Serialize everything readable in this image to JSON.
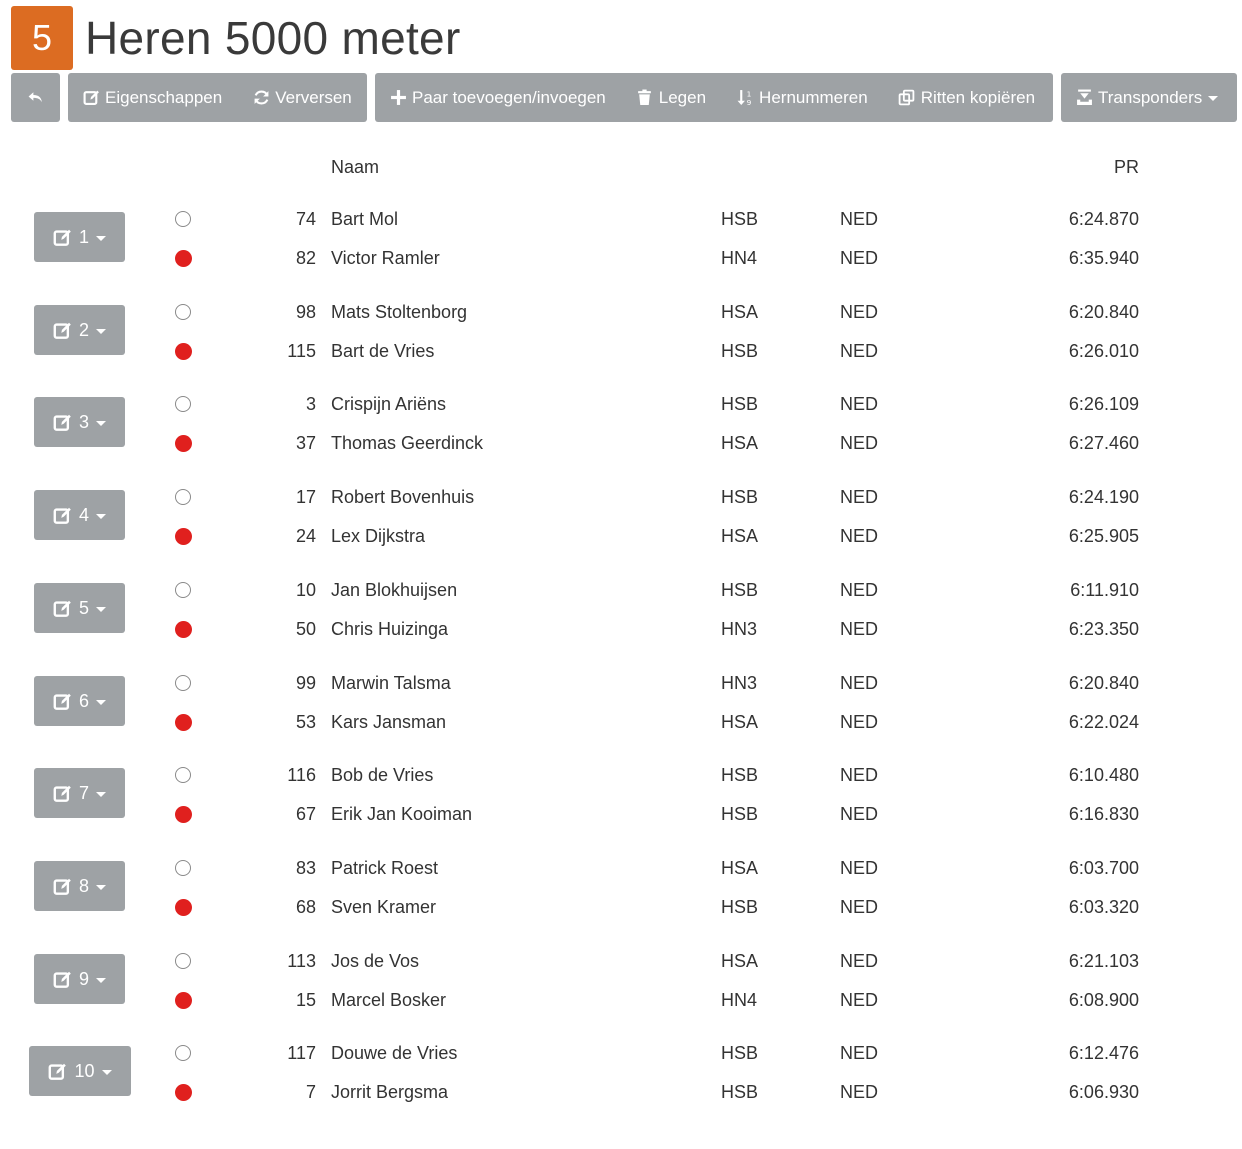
{
  "header": {
    "badge": "5",
    "title": "Heren 5000 meter"
  },
  "toolbar": {
    "back_icon": "back-arrow-icon",
    "properties": "Eigenschappen",
    "refresh": "Verversen",
    "add_pair": "Paar toevoegen/invoegen",
    "clear": "Legen",
    "renumber": "Hernummeren",
    "copy_heats": "Ritten kopiëren",
    "transponders": "Transponders"
  },
  "columns": {
    "name": "Naam",
    "pr": "PR"
  },
  "colors": {
    "badge": "#dc6c22",
    "button": "#9ea2a5",
    "red_lane": "#e0201e"
  },
  "heats": [
    {
      "label": "1",
      "pairs": [
        {
          "lane": "white",
          "num": "74",
          "name": "Bart Mol",
          "club": "HSB",
          "nat": "NED",
          "pr": "6:24.870"
        },
        {
          "lane": "red",
          "num": "82",
          "name": "Victor Ramler",
          "club": "HN4",
          "nat": "NED",
          "pr": "6:35.940"
        }
      ]
    },
    {
      "label": "2",
      "pairs": [
        {
          "lane": "white",
          "num": "98",
          "name": "Mats Stoltenborg",
          "club": "HSA",
          "nat": "NED",
          "pr": "6:20.840"
        },
        {
          "lane": "red",
          "num": "115",
          "name": "Bart de Vries",
          "club": "HSB",
          "nat": "NED",
          "pr": "6:26.010"
        }
      ]
    },
    {
      "label": "3",
      "pairs": [
        {
          "lane": "white",
          "num": "3",
          "name": "Crispijn Ariëns",
          "club": "HSB",
          "nat": "NED",
          "pr": "6:26.109"
        },
        {
          "lane": "red",
          "num": "37",
          "name": "Thomas Geerdinck",
          "club": "HSA",
          "nat": "NED",
          "pr": "6:27.460"
        }
      ]
    },
    {
      "label": "4",
      "pairs": [
        {
          "lane": "white",
          "num": "17",
          "name": "Robert Bovenhuis",
          "club": "HSB",
          "nat": "NED",
          "pr": "6:24.190"
        },
        {
          "lane": "red",
          "num": "24",
          "name": "Lex Dijkstra",
          "club": "HSA",
          "nat": "NED",
          "pr": "6:25.905"
        }
      ]
    },
    {
      "label": "5",
      "pairs": [
        {
          "lane": "white",
          "num": "10",
          "name": "Jan Blokhuijsen",
          "club": "HSB",
          "nat": "NED",
          "pr": "6:11.910"
        },
        {
          "lane": "red",
          "num": "50",
          "name": "Chris Huizinga",
          "club": "HN3",
          "nat": "NED",
          "pr": "6:23.350"
        }
      ]
    },
    {
      "label": "6",
      "pairs": [
        {
          "lane": "white",
          "num": "99",
          "name": "Marwin Talsma",
          "club": "HN3",
          "nat": "NED",
          "pr": "6:20.840"
        },
        {
          "lane": "red",
          "num": "53",
          "name": "Kars Jansman",
          "club": "HSA",
          "nat": "NED",
          "pr": "6:22.024"
        }
      ]
    },
    {
      "label": "7",
      "pairs": [
        {
          "lane": "white",
          "num": "116",
          "name": "Bob de Vries",
          "club": "HSB",
          "nat": "NED",
          "pr": "6:10.480"
        },
        {
          "lane": "red",
          "num": "67",
          "name": "Erik Jan Kooiman",
          "club": "HSB",
          "nat": "NED",
          "pr": "6:16.830"
        }
      ]
    },
    {
      "label": "8",
      "pairs": [
        {
          "lane": "white",
          "num": "83",
          "name": "Patrick Roest",
          "club": "HSA",
          "nat": "NED",
          "pr": "6:03.700"
        },
        {
          "lane": "red",
          "num": "68",
          "name": "Sven Kramer",
          "club": "HSB",
          "nat": "NED",
          "pr": "6:03.320"
        }
      ]
    },
    {
      "label": "9",
      "pairs": [
        {
          "lane": "white",
          "num": "113",
          "name": "Jos de Vos",
          "club": "HSA",
          "nat": "NED",
          "pr": "6:21.103"
        },
        {
          "lane": "red",
          "num": "15",
          "name": "Marcel Bosker",
          "club": "HN4",
          "nat": "NED",
          "pr": "6:08.900"
        }
      ]
    },
    {
      "label": "10",
      "pairs": [
        {
          "lane": "white",
          "num": "117",
          "name": "Douwe de Vries",
          "club": "HSB",
          "nat": "NED",
          "pr": "6:12.476"
        },
        {
          "lane": "red",
          "num": "7",
          "name": "Jorrit Bergsma",
          "club": "HSB",
          "nat": "NED",
          "pr": "6:06.930"
        }
      ]
    }
  ]
}
